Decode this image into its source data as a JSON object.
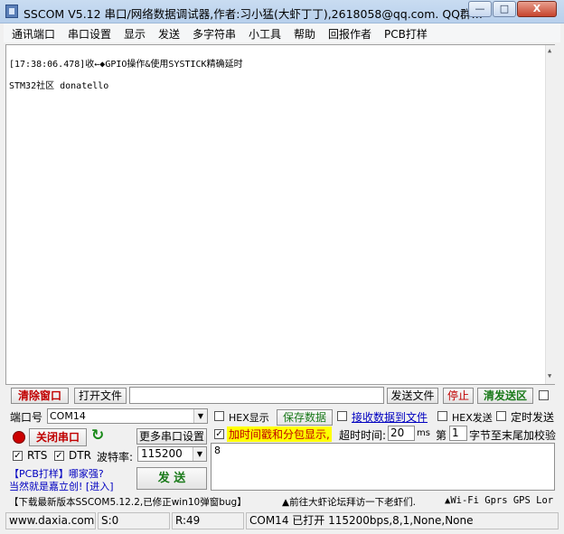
{
  "window": {
    "title": "SSCOM V5.12 串口/网络数据调试器,作者:习小猛(大虾丁丁),2618058@qq.com. QQ群…",
    "min_glyph": "—",
    "max_glyph": "□",
    "close_glyph": "X"
  },
  "menu": [
    "通讯端口",
    "串口设置",
    "显示",
    "发送",
    "多字符串",
    "小工具",
    "帮助",
    "回报作者",
    "PCB打样"
  ],
  "receive": {
    "lines": [
      "[17:38:06.478]收←◆GPIO操作&使用SYSTICK精确延时",
      "STM32社区 donatello"
    ]
  },
  "actions": {
    "clear_window": "清除窗口",
    "open_file": "打开文件",
    "file_path": "",
    "send_file": "发送文件",
    "stop": "停止",
    "clear_send_area": "清发送区"
  },
  "port": {
    "label": "端口号",
    "value": "COM14",
    "close_port": "关闭串口",
    "more_settings": "更多串口设置",
    "rts": "RTS",
    "dtr": "DTR",
    "baud_label": "波特率:",
    "baud_value": "115200",
    "pcb_line1": "【PCB打样】哪家强?",
    "pcb_line2": "当然就是嘉立创! [进入]",
    "send": "发 送"
  },
  "options": {
    "hex_display": "HEX显示",
    "save_data": "保存数据",
    "recv_to_file": "接收数据到文件",
    "hex_send": "HEX发送",
    "timed_send": "定时发送",
    "timestamp": "加时间戳和分包显示,",
    "timeout_label": "超时时间:",
    "timeout_value": "20",
    "timeout_unit": "ms",
    "byte_prefix": "第",
    "byte_value": "1",
    "byte_suffix": "字节至末尾加校验",
    "send_text": "8"
  },
  "ticker": {
    "left": "【下载最新版本SSCOM5.12.2,已修正win10弹窗bug】",
    "mid": "▲前往大虾论坛拜访一下老虾们.",
    "right": "▲Wi-Fi Gprs GPS Lor"
  },
  "status": {
    "site": "www.daxia.com",
    "sent": "S:0",
    "received": "R:49",
    "port_info": "COM14 已打开  115200bps,8,1,None,None"
  },
  "colors": {
    "accent_red": "#c00000",
    "accent_green": "#1a7a1a",
    "highlight": "#ffff00"
  }
}
